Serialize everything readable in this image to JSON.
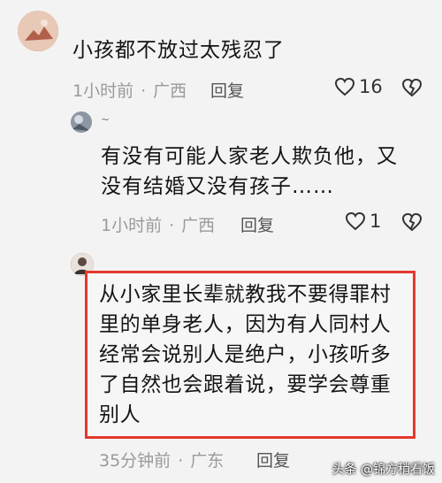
{
  "comments": [
    {
      "text": "小孩都不放过太残忍了",
      "time": "1小时前",
      "location": "广西",
      "reply_label": "回复",
      "likes": "16"
    },
    {
      "username": "~",
      "text_lines": [
        "有没有可能人家老人欺负他，又",
        "没有结婚又没有孩子……"
      ],
      "time": "1小时前",
      "location": "广西",
      "reply_label": "回复",
      "likes": "1"
    },
    {
      "text_lines": [
        "从小家里长辈就教我不要得罪村",
        "里的单身老人，因为有人同村人",
        "经常会说别人是绝户，小孩听多",
        "了自然也会跟着说，要学会尊重",
        "别人"
      ],
      "time": "35分钟前",
      "location": "广东",
      "reply_label": "回复"
    }
  ],
  "separator": "·",
  "watermark": "头条 @锦方稍看饭",
  "colors": {
    "highlight_border": "#e3392d",
    "meta": "#9a9a9a"
  }
}
